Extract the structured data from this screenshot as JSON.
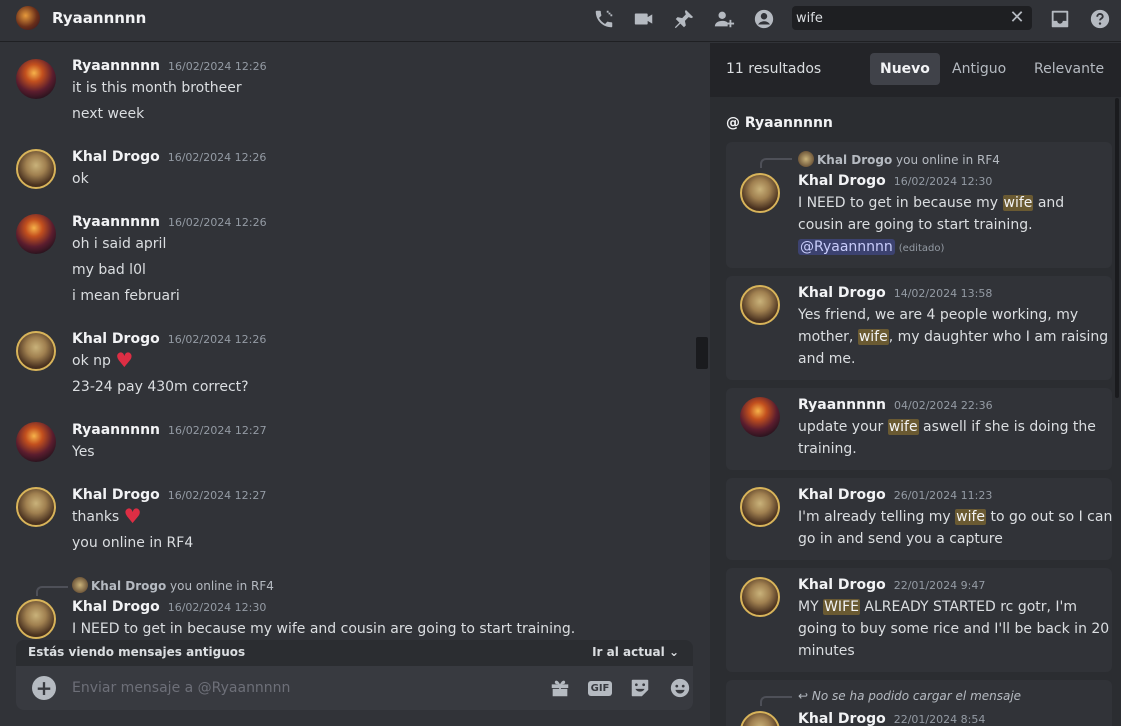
{
  "header": {
    "title": "Ryaannnnn",
    "search_value": "wife",
    "icons": [
      "call-icon",
      "video-icon",
      "pin-icon",
      "add-member-icon",
      "profile-icon",
      "inbox-icon",
      "help-icon"
    ]
  },
  "chat": {
    "messages": [
      {
        "author": "Ryaannnnn",
        "time": "16/02/2024 12:26",
        "lines": [
          "it is this month brotheer",
          "next week"
        ]
      },
      {
        "author": "Khal Drogo",
        "time": "16/02/2024 12:26",
        "lines": [
          "ok"
        ]
      },
      {
        "author": "Ryaannnnn",
        "time": "16/02/2024 12:26",
        "lines": [
          "oh i said april",
          "my bad l0l",
          "i mean februari"
        ]
      },
      {
        "author": "Khal Drogo",
        "time": "16/02/2024 12:26",
        "lines": [
          "ok np",
          "23-24 pay 430m correct?"
        ]
      },
      {
        "author": "Ryaannnnn",
        "time": "16/02/2024 12:27",
        "lines": [
          "Yes"
        ]
      },
      {
        "author": "Khal Drogo",
        "time": "16/02/2024 12:27",
        "lines": [
          "thanks",
          "you online in RF4"
        ]
      },
      {
        "author": "Khal Drogo",
        "time": "16/02/2024 12:30",
        "lines": [
          "I NEED to get in because my wife and cousin are going to start training."
        ],
        "reply": {
          "author": "Khal Drogo",
          "text": "you online in RF4"
        }
      }
    ],
    "old_messages_notice": "Estás viendo mensajes antiguos",
    "jump_label": "Ir al actual",
    "composer_placeholder": "Enviar mensaje a @Ryaannnnn",
    "gif_label": "GIF"
  },
  "results": {
    "count": "11 resultados",
    "tabs": [
      "Nuevo",
      "Antiguo",
      "Relevante"
    ],
    "active_tab": "Nuevo",
    "channel": "@ Ryaannnnn",
    "items": [
      {
        "author": "Khal Drogo",
        "time": "16/02/2024 12:30",
        "reply": {
          "author": "Khal Drogo",
          "text": "you online in RF4"
        },
        "parts": [
          "I NEED to get in because my ",
          "wife",
          " and",
          "cousin are going to start training."
        ],
        "mention": "@Ryaannnnn",
        "edited": "(editado)"
      },
      {
        "author": "Khal Drogo",
        "time": "14/02/2024 13:58",
        "parts": [
          "Yes friend, we are 4 people working, my",
          "mother, ",
          "wife",
          ", my daughter who I am raising",
          "and me."
        ]
      },
      {
        "author": "Ryaannnnn",
        "time": "04/02/2024 22:36",
        "parts": [
          "update your ",
          "wife",
          " aswell if she is doing the",
          "training."
        ]
      },
      {
        "author": "Khal Drogo",
        "time": "26/01/2024 11:23",
        "parts": [
          "I'm already telling my ",
          "wife",
          " to go out so I can",
          "go in and send you a capture"
        ]
      },
      {
        "author": "Khal Drogo",
        "time": "22/01/2024 9:47",
        "parts": [
          "MY ",
          "WIFE",
          " ALREADY STARTED rc gotr, I'm",
          "going to buy some rice and I'll be back in 20",
          "minutes"
        ]
      },
      {
        "author": "Khal Drogo",
        "time": "22/01/2024 8:54",
        "reply_error": "No se ha podido cargar el mensaje"
      }
    ]
  }
}
